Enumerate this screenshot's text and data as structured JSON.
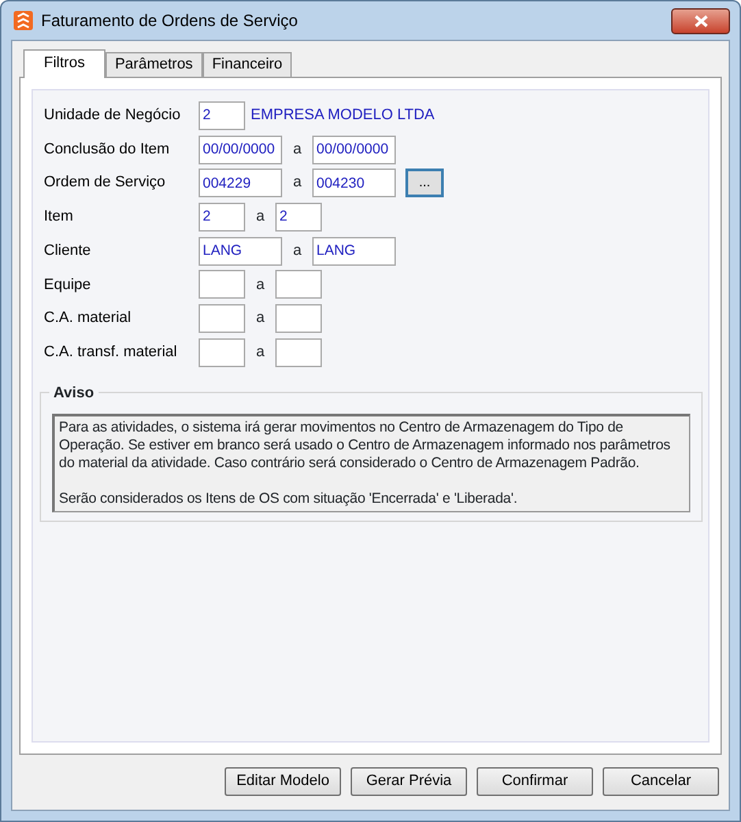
{
  "window": {
    "title": "Faturamento de Ordens de Serviço"
  },
  "tabs": [
    {
      "label": "Filtros",
      "selected": true
    },
    {
      "label": "Parâmetros",
      "selected": false
    },
    {
      "label": "Financeiro",
      "selected": false
    }
  ],
  "filters": [
    {
      "label": "Unidade de Negócio",
      "kind": "single",
      "from": "2",
      "description": "EMPRESA MODELO LTDA"
    },
    {
      "label": "Conclusão do Item",
      "kind": "wide",
      "from": "00/00/0000",
      "separator": "a",
      "to": "00/00/0000"
    },
    {
      "label": "Ordem de Serviço",
      "kind": "wide",
      "from": "004229",
      "separator": "a",
      "to": "004230",
      "lookup_button": "..."
    },
    {
      "label": "Item",
      "kind": "narrow",
      "from": "2",
      "separator": "a",
      "to": "2"
    },
    {
      "label": "Cliente",
      "kind": "wide",
      "from": "LANG",
      "separator": "a",
      "to": "LANG"
    },
    {
      "label": "Equipe",
      "kind": "narrow",
      "separator": "a"
    },
    {
      "label": "C.A. material",
      "kind": "narrow",
      "separator": "a"
    },
    {
      "label": "C.A. transf. material",
      "kind": "narrow",
      "separator": "a"
    }
  ],
  "notice": {
    "title": "Aviso",
    "paragraphs": [
      "Para as atividades, o sistema irá gerar movimentos no Centro de Armazenagem do Tipo de Operação. Se estiver em branco será usado o Centro de Armazenagem informado nos parâmetros do material da atividade. Caso contrário será considerado o Centro de Armazenagem Padrão.",
      "Serão considerados os Itens de OS com situação 'Encerrada' e 'Liberada'."
    ]
  },
  "buttons": [
    "Editar Modelo",
    "Gerar Prévia",
    "Confirmar",
    "Cancelar"
  ]
}
